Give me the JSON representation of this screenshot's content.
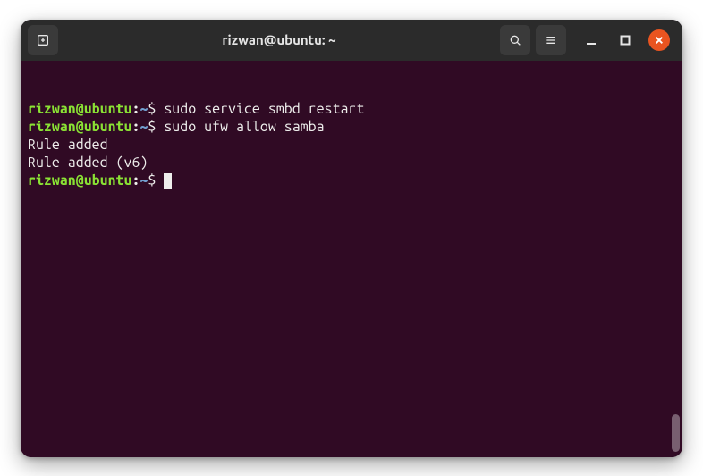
{
  "window": {
    "title": "rizwan@ubuntu: ~"
  },
  "terminal": {
    "prompt": {
      "userhost": "rizwan@ubuntu",
      "colon": ":",
      "path": "~",
      "symbol": "$"
    },
    "lines": [
      {
        "type": "cmd",
        "text": "sudo service smbd restart"
      },
      {
        "type": "cmd",
        "text": "sudo ufw allow samba"
      },
      {
        "type": "out",
        "text": "Rule added"
      },
      {
        "type": "out",
        "text": "Rule added (v6)"
      },
      {
        "type": "cmd-cursor",
        "text": ""
      }
    ]
  }
}
